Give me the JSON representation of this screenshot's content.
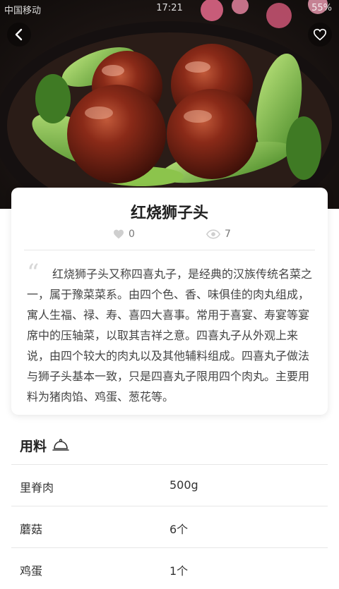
{
  "status_bar": {
    "carrier": "中国移动",
    "time": "17:21",
    "battery": "55%"
  },
  "hero": {
    "back_icon": "chevron-left-icon",
    "favorite_icon": "heart-outline-icon"
  },
  "recipe": {
    "title": "红烧狮子头",
    "likes": "0",
    "views": "7",
    "description": "红烧狮子头又称四喜丸子，是经典的汉族传统名菜之一，属于豫菜菜系。由四个色、香、味俱佳的肉丸组成，寓人生福、禄、寿、喜四大喜事。常用于喜宴、寿宴等宴席中的压轴菜，以取其吉祥之意。四喜丸子从外观上来说，由四个较大的肉丸以及其他辅料组成。四喜丸子做法与狮子头基本一致，只是四喜丸子限用四个肉丸。主要用料为猪肉馅、鸡蛋、葱花等。"
  },
  "ingredients": {
    "title": "用料",
    "items": [
      {
        "name": "里脊肉",
        "amount": "500g"
      },
      {
        "name": "蘑菇",
        "amount": "6个"
      },
      {
        "name": "鸡蛋",
        "amount": "1个"
      }
    ]
  }
}
